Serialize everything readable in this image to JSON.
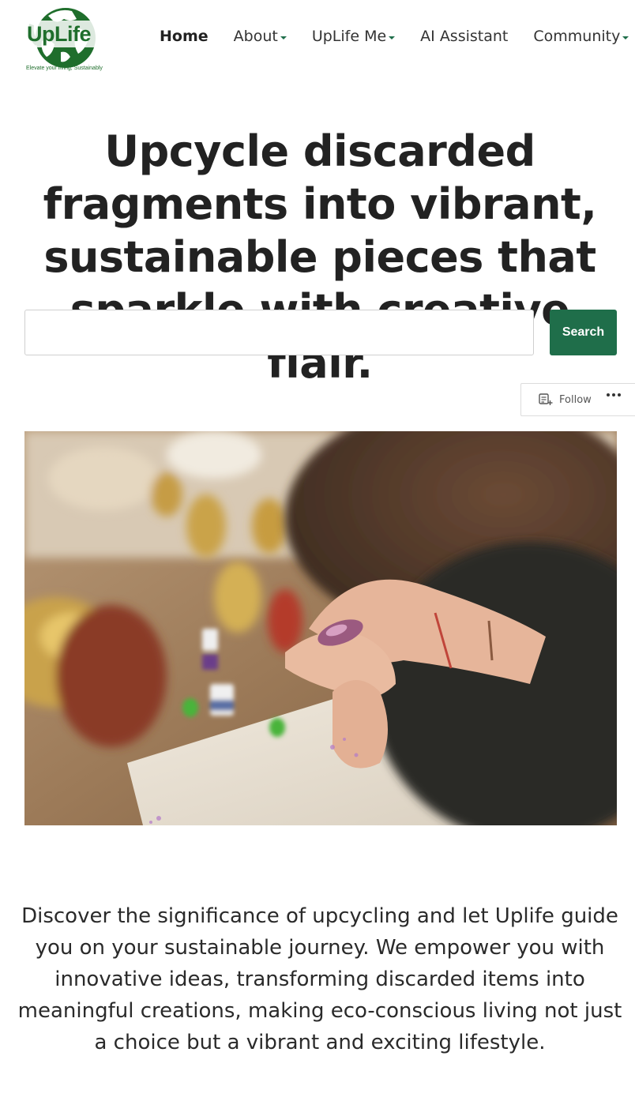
{
  "brand": {
    "title": "UpLife",
    "tagline": "Elevate your living, Sustainably",
    "color": "#1f6e2c"
  },
  "nav": {
    "items": [
      {
        "label": "Home",
        "active": true,
        "has_dropdown": false
      },
      {
        "label": "About",
        "active": false,
        "has_dropdown": true
      },
      {
        "label": "UpLife Me",
        "active": false,
        "has_dropdown": true
      },
      {
        "label": "AI Assistant",
        "active": false,
        "has_dropdown": false
      },
      {
        "label": "Community",
        "active": false,
        "has_dropdown": true
      }
    ]
  },
  "hero": {
    "title": "Upcycle discarded fragments into vibrant, sustainable pieces that sparkle with creative flair."
  },
  "search": {
    "placeholder": "",
    "value": "",
    "button_label": "Search",
    "accent_color": "#1f6e4a"
  },
  "follow_bar": {
    "follow_label": "Follow",
    "follow_icon": "reader-follow-icon",
    "more_icon": "ellipsis-icon"
  },
  "image": {
    "subject": "crafting-photo"
  },
  "intro": {
    "text": "Discover the significance of upcycling and let Uplife guide you on your sustainable journey. We empower you with innovative ideas, transforming discarded items into meaningful creations, making eco-conscious living not just a choice but a vibrant and exciting lifestyle."
  }
}
